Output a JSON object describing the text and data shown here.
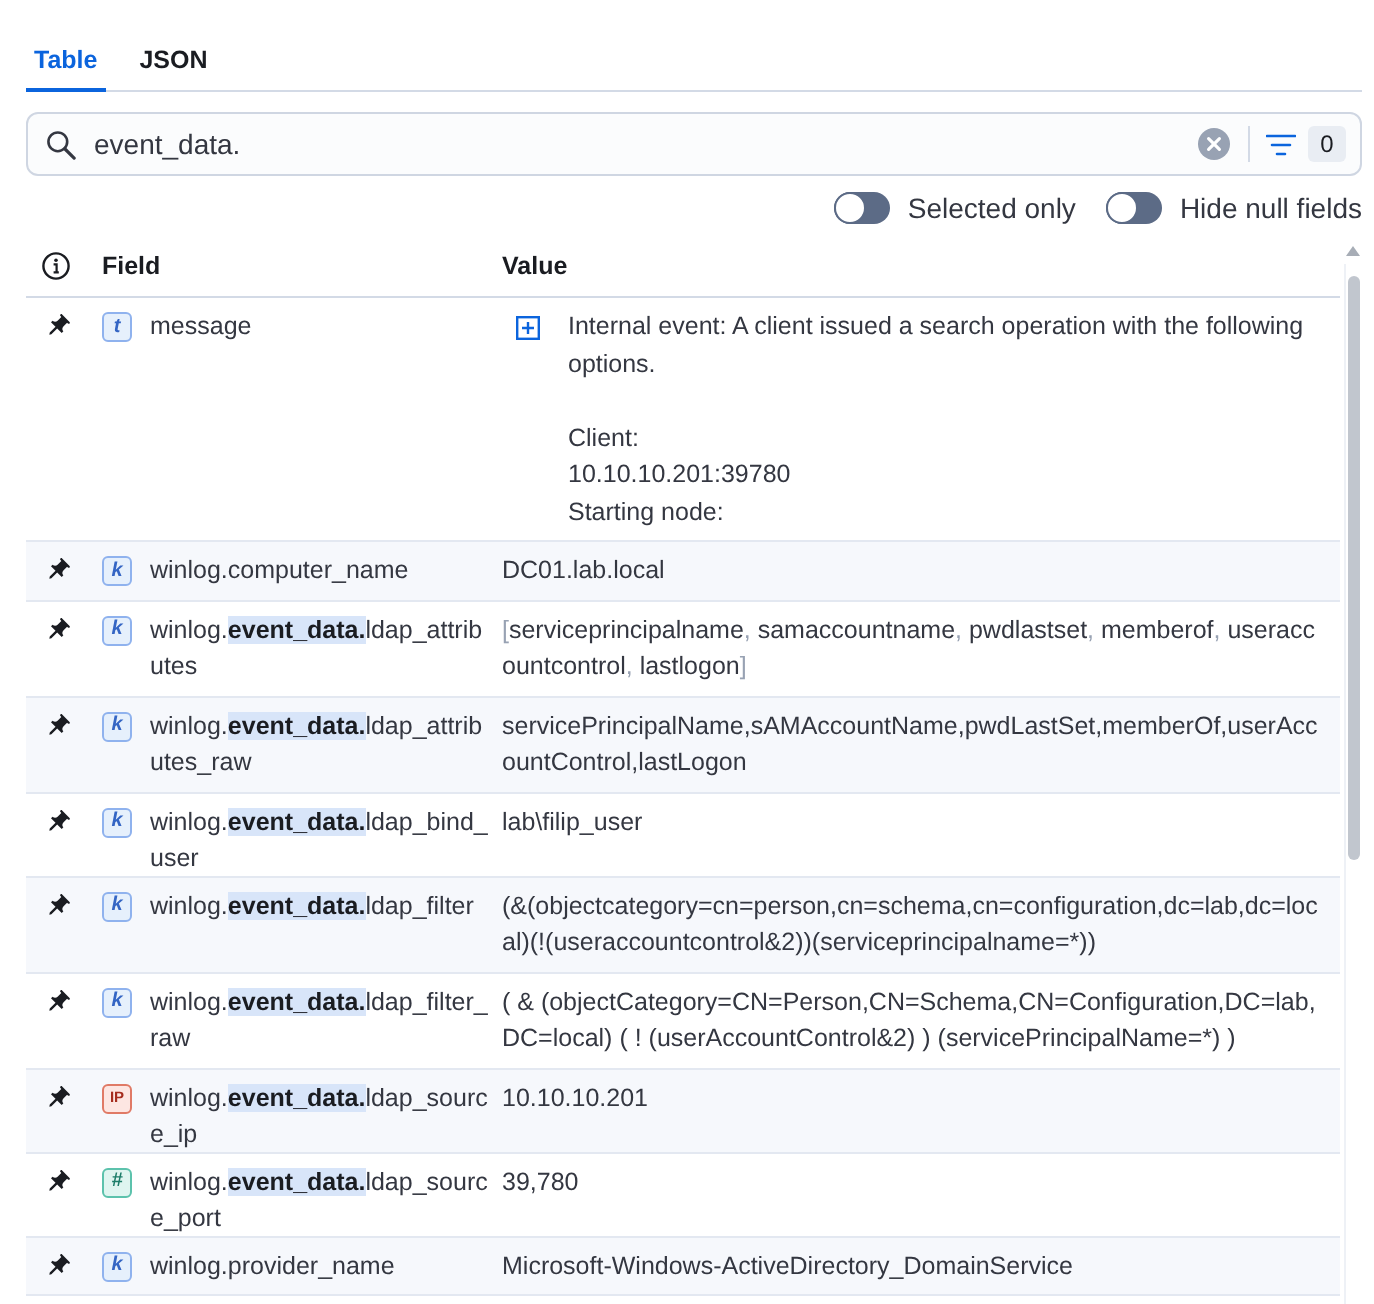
{
  "tabs": [
    {
      "label": "Table",
      "selected": true
    },
    {
      "label": "JSON",
      "selected": false
    }
  ],
  "search": {
    "value": "event_data.",
    "filter_count": "0"
  },
  "toggles": [
    {
      "label": "Selected only",
      "on": false
    },
    {
      "label": "Hide null fields",
      "on": false
    }
  ],
  "table": {
    "columns": [
      "Field",
      "Value"
    ],
    "rows": [
      {
        "type": {
          "kind": "text",
          "label": "t"
        },
        "field": "message",
        "expandable": true,
        "value": {
          "kind": "multiline",
          "text": "Internal event: A client issued a search operation with the following options.\n\nClient:\n10.10.10.201:39780\nStarting node:"
        }
      },
      {
        "type": {
          "kind": "keyword",
          "label": "k"
        },
        "field": "winlog.computer_name",
        "expandable": false,
        "value": {
          "kind": "plain",
          "text": "DC01.lab.local"
        }
      },
      {
        "type": {
          "kind": "keyword",
          "label": "k"
        },
        "field": "winlog.**event_data.**ldap_attributes",
        "expandable": false,
        "value": {
          "kind": "array",
          "open": "[",
          "close": "]",
          "separator": ", ",
          "items": [
            "serviceprincipalname",
            "samaccountname",
            "pwdlastset",
            "memberof",
            "useraccountcontrol",
            "lastlogon"
          ]
        }
      },
      {
        "type": {
          "kind": "keyword",
          "label": "k"
        },
        "field": "winlog.**event_data.**ldap_attributes_raw",
        "expandable": false,
        "value": {
          "kind": "plain",
          "text": "servicePrincipalName,sAMAccountName,pwdLastSet,memberOf,userAccountControl,lastLogon"
        }
      },
      {
        "type": {
          "kind": "keyword",
          "label": "k"
        },
        "field": "winlog.**event_data.**ldap_bind_user",
        "expandable": false,
        "value": {
          "kind": "plain",
          "text": "lab\\filip_user"
        }
      },
      {
        "type": {
          "kind": "keyword",
          "label": "k"
        },
        "field": "winlog.**event_data.**ldap_filter",
        "expandable": false,
        "value": {
          "kind": "plain",
          "text": "(&(objectcategory=cn=person,cn=schema,cn=configuration,dc=lab,dc=local)(!(useraccountcontrol&2))(serviceprincipalname=*))"
        }
      },
      {
        "type": {
          "kind": "keyword",
          "label": "k"
        },
        "field": "winlog.**event_data.**ldap_filter_raw",
        "expandable": false,
        "value": {
          "kind": "plain",
          "text": "( & (objectCategory=CN=Person,CN=Schema,CN=Configuration,DC=lab,DC=local) ( ! (userAccountControl&2) ) (servicePrincipalName=*) )"
        }
      },
      {
        "type": {
          "kind": "ip",
          "label": "IP"
        },
        "field": "winlog.**event_data.**ldap_source_ip",
        "expandable": false,
        "value": {
          "kind": "plain",
          "text": "10.10.10.201"
        }
      },
      {
        "type": {
          "kind": "number",
          "label": "#"
        },
        "field": "winlog.**event_data.**ldap_source_port",
        "expandable": false,
        "value": {
          "kind": "plain",
          "text": "39,780"
        }
      },
      {
        "type": {
          "kind": "keyword",
          "label": "k"
        },
        "field": "winlog.provider_name",
        "expandable": false,
        "value": {
          "kind": "plain",
          "text": "Microsoft-Windows-ActiveDirectory_DomainService"
        }
      }
    ]
  }
}
